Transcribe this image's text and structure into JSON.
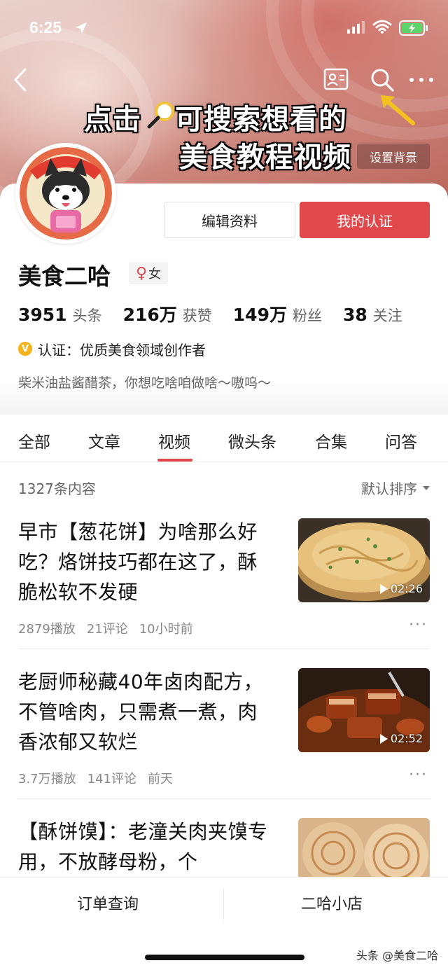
{
  "status": {
    "time": "6:25"
  },
  "banner": {
    "hint_line1_a": "点击",
    "hint_line1_b": "可搜索想看的",
    "hint_line2": "美食教程视频",
    "set_background": "设置背景"
  },
  "profile": {
    "name": "美食二哈",
    "gender": "女",
    "gender_symbol": "♀",
    "buttons": {
      "edit": "编辑资料",
      "certification": "我的认证"
    },
    "stats": [
      {
        "num": "3951",
        "label": "头条"
      },
      {
        "num": "216万",
        "label": "获赞"
      },
      {
        "num": "149万",
        "label": "粉丝"
      },
      {
        "num": "38",
        "label": "关注"
      }
    ],
    "cert_badge": "V",
    "certification": "认证：优质美食领域创作者",
    "bio": "柴米油盐酱醋茶，你想吃啥咱做啥～嗷呜～"
  },
  "tabs": [
    "全部",
    "文章",
    "视频",
    "微头条",
    "合集",
    "问答"
  ],
  "active_tab": "视频",
  "list": {
    "count": "1327条内容",
    "sort": "默认排序",
    "items": [
      {
        "title": "早市【葱花饼】为啥那么好吃？烙饼技巧都在这了，酥脆松软不发硬",
        "duration": "02:26",
        "plays": "2879播放",
        "comments": "21评论",
        "time": "10小时前"
      },
      {
        "title": "老厨师秘藏40年卤肉配方，不管啥肉，只需煮一煮，肉香浓郁又软烂",
        "duration": "02:52",
        "plays": "3.7万播放",
        "comments": "141评论",
        "time": "前天"
      },
      {
        "title": "【酥饼馍】：老潼关肉夹馍专用，不放酵母粉，个",
        "duration": "",
        "plays": "",
        "comments": "",
        "time": ""
      }
    ]
  },
  "bottom": {
    "orders": "订单查询",
    "shop": "二哈小店",
    "watermark": "头条 @美食二哈"
  },
  "colors": {
    "accent": "#e0484b",
    "badge": "#f5b21a"
  }
}
